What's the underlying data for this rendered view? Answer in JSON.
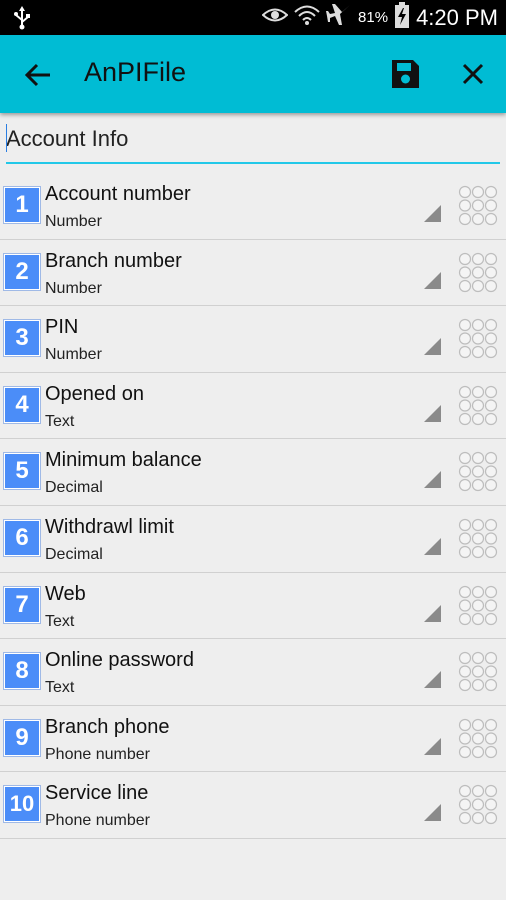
{
  "status_bar": {
    "battery_percent": "81%",
    "time": "4:20 PM",
    "icons": [
      "usb-icon",
      "eye-icon",
      "wifi-icon",
      "airplane-icon",
      "battery-icon"
    ]
  },
  "app_bar": {
    "title": "AnPIFile",
    "background": "#00bcd4",
    "icons": [
      "back-arrow-icon",
      "save-icon",
      "close-icon"
    ]
  },
  "form": {
    "title_value": "Account Info",
    "accent": "#22c8e8"
  },
  "fields": [
    {
      "index": "1",
      "name": "Account number",
      "type": "Number"
    },
    {
      "index": "2",
      "name": "Branch number",
      "type": "Number"
    },
    {
      "index": "3",
      "name": "PIN",
      "type": "Number"
    },
    {
      "index": "4",
      "name": "Opened on",
      "type": "Text"
    },
    {
      "index": "5",
      "name": "Minimum balance",
      "type": "Decimal"
    },
    {
      "index": "6",
      "name": "Withdrawl limit",
      "type": "Decimal"
    },
    {
      "index": "7",
      "name": "Web",
      "type": "Text"
    },
    {
      "index": "8",
      "name": "Online password",
      "type": "Text"
    },
    {
      "index": "9",
      "name": "Branch phone",
      "type": "Phone number"
    },
    {
      "index": "10",
      "name": "Service line",
      "type": "Phone number"
    }
  ],
  "colors": {
    "index_badge": "#4b8df8"
  }
}
